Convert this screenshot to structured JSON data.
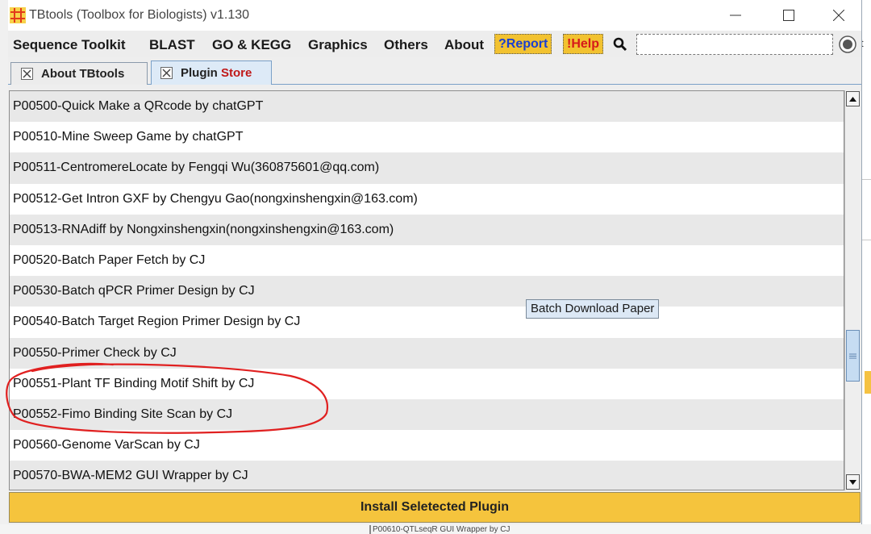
{
  "window": {
    "title": "TBtools (Toolbox for Biologists) v1.130",
    "app_icon": "tbtools-grid-icon"
  },
  "menu": {
    "items": [
      "Sequence Toolkit",
      "BLAST",
      "GO & KEGG",
      "Graphics",
      "Others",
      "About"
    ],
    "report_label": "?Report",
    "help_label": "!Help",
    "search_value": "",
    "search_placeholder": ""
  },
  "tabs": {
    "about_label": "About TBtools",
    "store_label_plugin": "Plugin",
    "store_label_store": "Store",
    "active": "Plugin Store"
  },
  "plugins": [
    "P00500-Quick Make a QRcode by chatGPT",
    "P00510-Mine Sweep Game by chatGPT",
    "P00511-CentromereLocate by Fengqi Wu(360875601@qq.com)",
    "P00512-Get Intron GXF by Chengyu Gao(nongxinshengxin@163.com)",
    "P00513-RNAdiff by Nongxinshengxin(nongxinshengxin@163.com)",
    "P00520-Batch Paper Fetch by CJ",
    "P00530-Batch qPCR Primer Design by CJ",
    "P00540-Batch Target Region Primer Design by CJ",
    "P00550-Primer Check by CJ",
    "P00551-Plant TF Binding Motif Shift by CJ",
    "P00552-Fimo Binding Site Scan by CJ",
    "P00560-Genome VarScan by CJ",
    "P00570-BWA-MEM2 GUI Wrapper by CJ"
  ],
  "tooltip": "Batch Download Paper",
  "install_button": "Install Seletected Plugin",
  "background_fragments": {
    "bottom_text": "P00610-QTLseqR GUI Wrapper by CJ",
    "right_text": "t"
  },
  "colors": {
    "install_button": "#f5c43d",
    "report_text": "#1b3fd0",
    "help_text": "#d61a1a",
    "store_text": "#c01818",
    "annotation_circle": "#e02020",
    "tooltip_bg": "#dce8f5"
  }
}
